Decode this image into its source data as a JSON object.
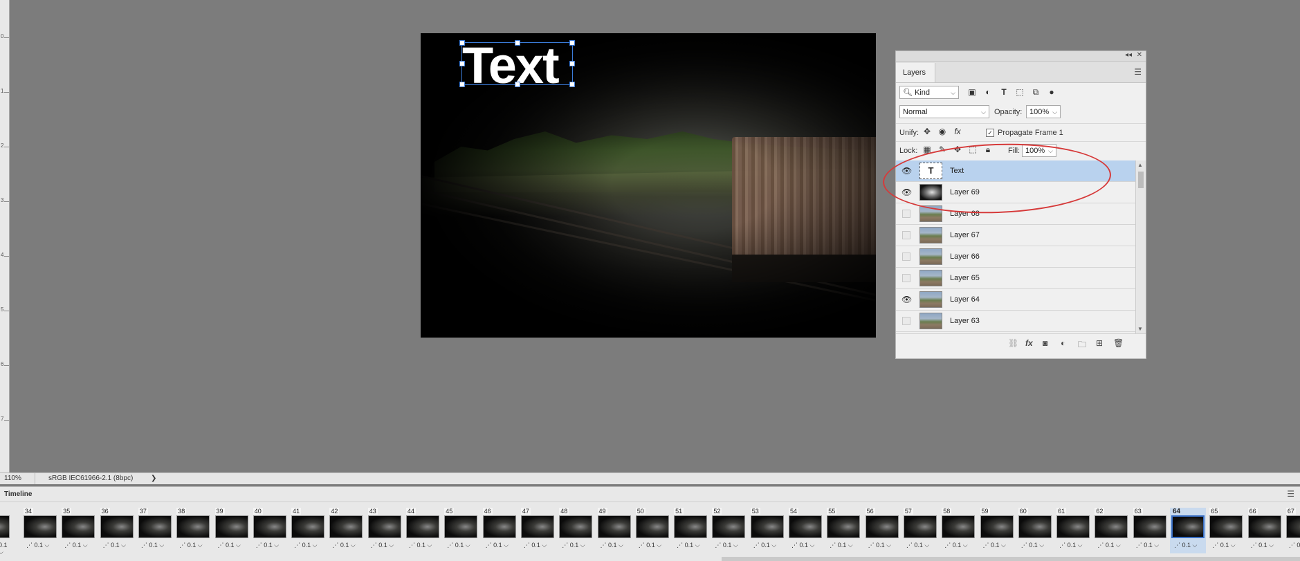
{
  "status": {
    "zoom": "110%",
    "profile": "sRGB IEC61966-2.1 (8bpc)",
    "arrow": "❯"
  },
  "canvas": {
    "text_layer": "Text"
  },
  "layers_panel": {
    "title": "Layers",
    "filter": "Kind",
    "blend_mode": "Normal",
    "opacity_label": "Opacity:",
    "opacity": "100%",
    "unify_label": "Unify:",
    "propagate_label": "Propagate Frame 1",
    "lock_label": "Lock:",
    "fill_label": "Fill:",
    "fill": "100%",
    "layers": [
      {
        "name": "Text",
        "visible": true,
        "selected": true,
        "thumb": "text"
      },
      {
        "name": "Layer 69",
        "visible": true,
        "selected": false,
        "thumb": "dark"
      },
      {
        "name": "Layer 68",
        "visible": false,
        "selected": false,
        "thumb": "photo"
      },
      {
        "name": "Layer 67",
        "visible": false,
        "selected": false,
        "thumb": "photo"
      },
      {
        "name": "Layer 66",
        "visible": false,
        "selected": false,
        "thumb": "photo"
      },
      {
        "name": "Layer 65",
        "visible": false,
        "selected": false,
        "thumb": "photo"
      },
      {
        "name": "Layer 64",
        "visible": true,
        "selected": false,
        "thumb": "photo"
      },
      {
        "name": "Layer 63",
        "visible": false,
        "selected": false,
        "thumb": "photo"
      }
    ]
  },
  "timeline": {
    "title": "Timeline",
    "delay": "0.1",
    "frames": [
      "34",
      "35",
      "36",
      "37",
      "38",
      "39",
      "40",
      "41",
      "42",
      "43",
      "44",
      "45",
      "46",
      "47",
      "48",
      "49",
      "50",
      "51",
      "52",
      "53",
      "54",
      "55",
      "56",
      "57",
      "58",
      "59",
      "60",
      "61",
      "62",
      "63",
      "64",
      "65",
      "66",
      "67"
    ],
    "active_frame": "64"
  },
  "ruler_ticks": [
    "0",
    "1",
    "2",
    "3",
    "4",
    "5",
    "6",
    "7"
  ]
}
